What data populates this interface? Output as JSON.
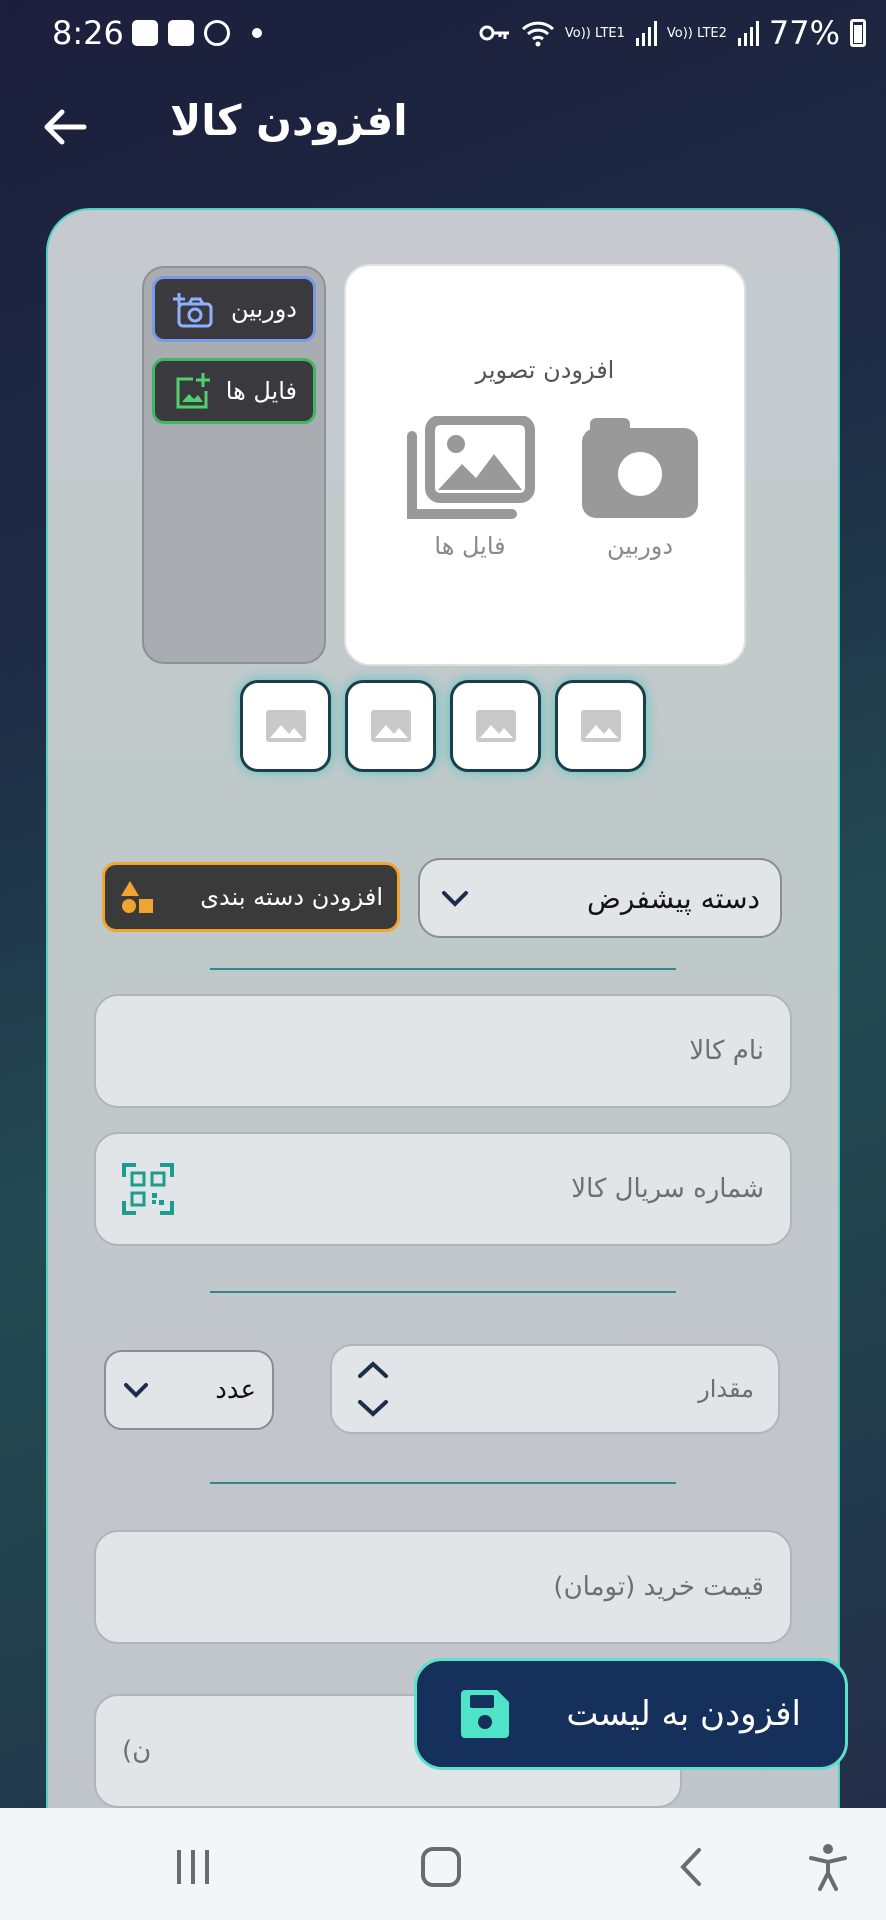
{
  "status_bar": {
    "time": "8:26",
    "sim1": "Vo)) LTE1",
    "sim2": "Vo)) LTE2",
    "battery": "77%"
  },
  "app_bar": {
    "title": "افزودن کالا"
  },
  "image_picker": {
    "camera_button": "دوربین",
    "files_button": "فایل ها",
    "preview_title": "افزودن تصویر",
    "preview_camera_label": "دوربین",
    "preview_files_label": "فایل ها",
    "thumbnail_count": 4
  },
  "category": {
    "selected": "دسته پیشفرض",
    "add_button": "افزودن دسته بندی"
  },
  "fields": {
    "name_placeholder": "نام کالا",
    "serial_placeholder": "شماره سریال کالا",
    "quantity_placeholder": "مقدار",
    "unit_selected": "عدد",
    "purchase_price_placeholder": "قیمت خرید (تومان)",
    "partial_field_text": "ن)"
  },
  "fab": {
    "label": "افزودن به لیست"
  },
  "colors": {
    "accent": "#4fd3c0",
    "fab_bg": "#15305a",
    "category_btn_border": "#f0a431",
    "files_btn_border": "#3fb861",
    "camera_btn_border": "#7a97e8"
  }
}
